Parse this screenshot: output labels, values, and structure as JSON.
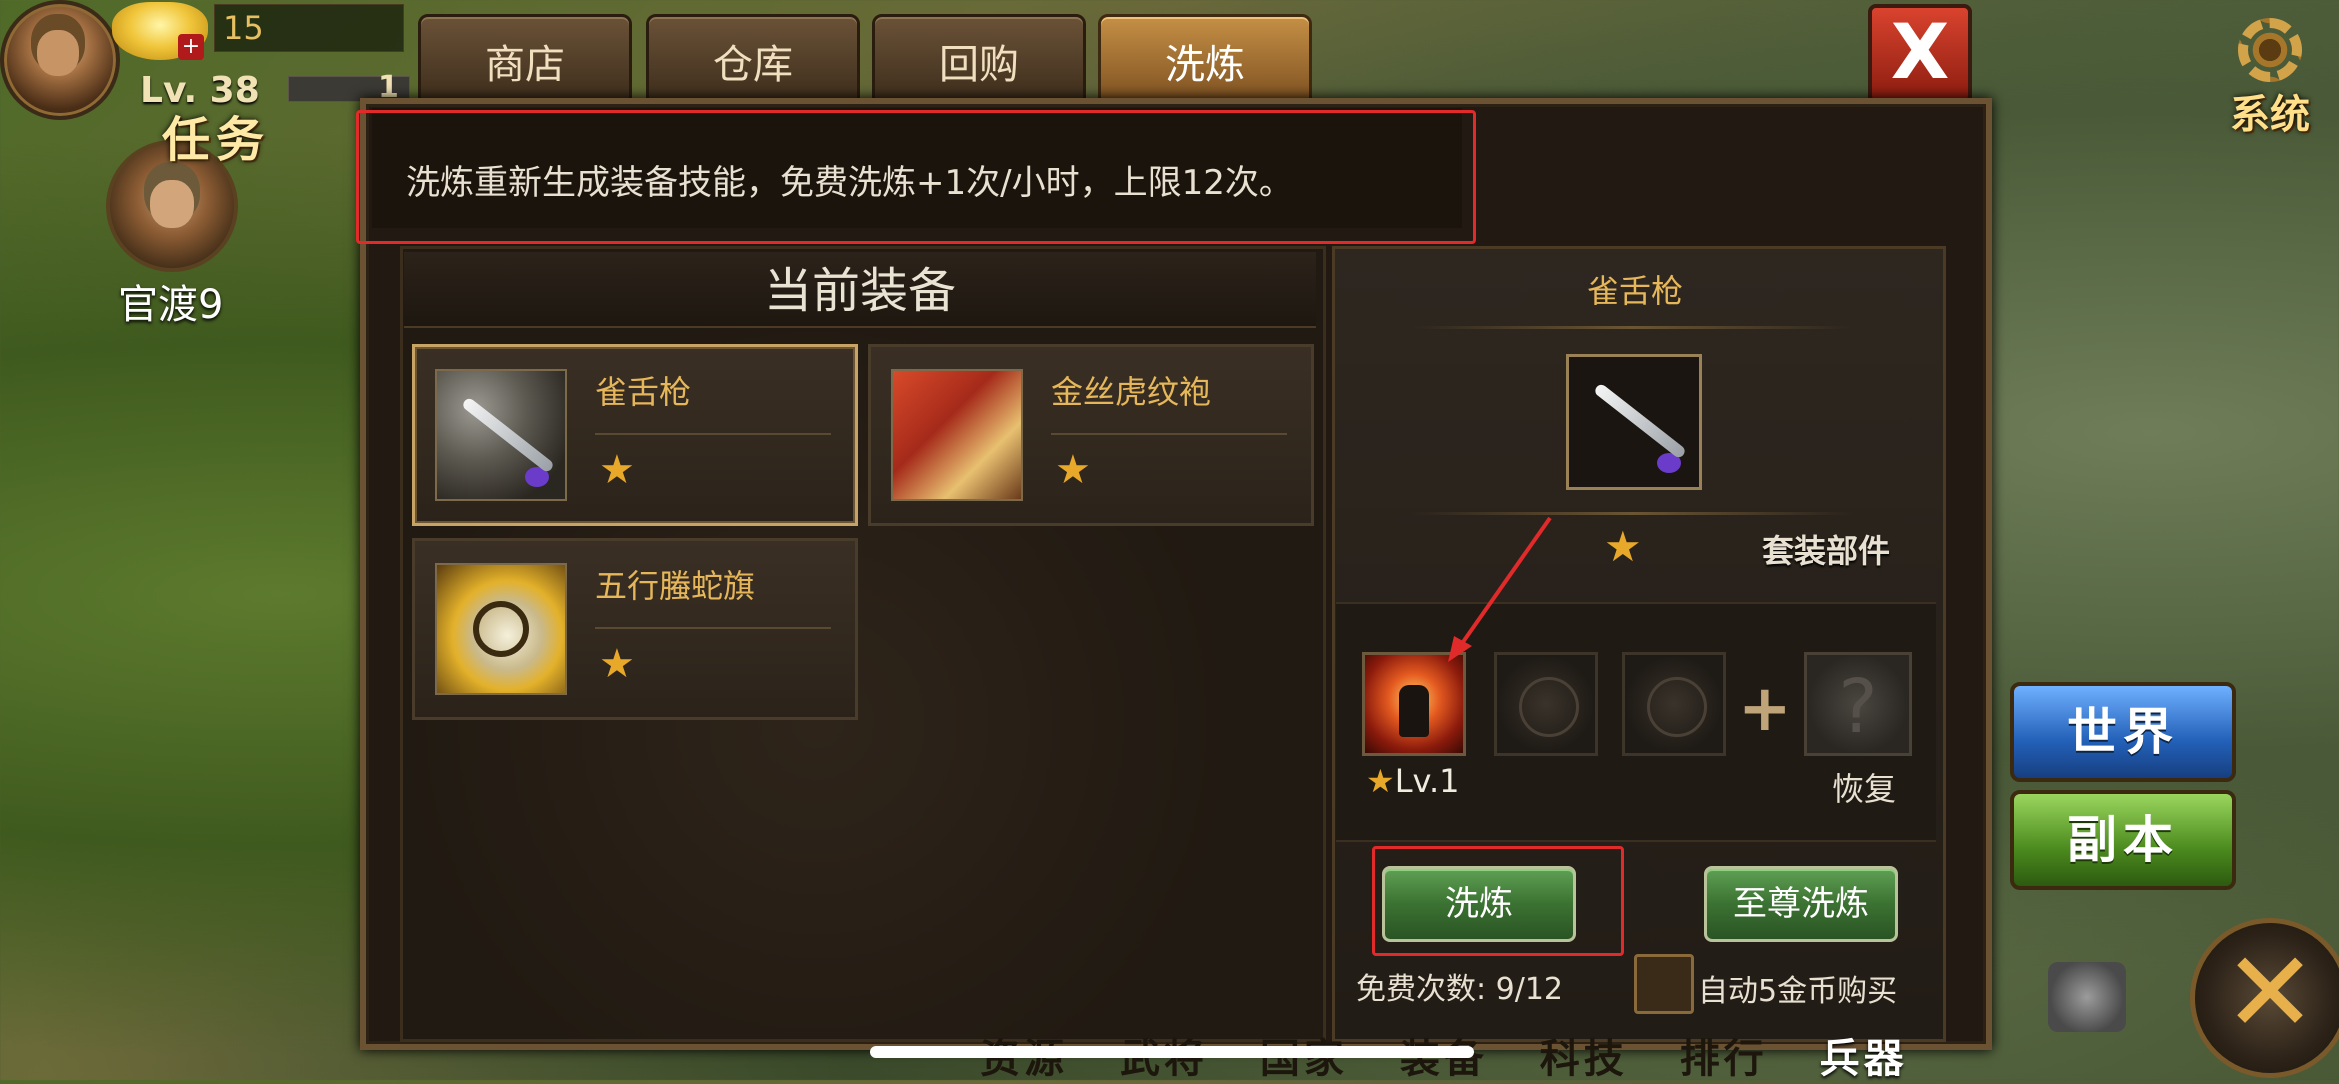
{
  "hud": {
    "gold_count": "15",
    "level": "Lv. 38",
    "exp_partial": "1",
    "quest_label": "任务",
    "location": "官渡9",
    "system_label": "系统"
  },
  "tabs": [
    {
      "label": "商店",
      "active": false
    },
    {
      "label": "仓库",
      "active": false
    },
    {
      "label": "回购",
      "active": false
    },
    {
      "label": "洗炼",
      "active": true
    }
  ],
  "close_label": "X",
  "notice": "洗炼重新生成装备技能，免费洗炼+1次/小时，上限12次。",
  "current_equipment": {
    "header": "当前装备",
    "items": [
      {
        "name": "雀舌枪",
        "star": "★",
        "selected": true,
        "icon": "spear-icon"
      },
      {
        "name": "金丝虎纹袍",
        "star": "★",
        "selected": false,
        "icon": "robe-icon"
      },
      {
        "name": "五行螣蛇旗",
        "star": "★",
        "selected": false,
        "icon": "banner-icon"
      }
    ]
  },
  "detail": {
    "title": "雀舌枪",
    "star": "★",
    "set_part_label": "套装部件",
    "skill_level": "Lv.1",
    "skill_star": "★",
    "restore_label": "恢复",
    "help_glyph": "?",
    "plus_glyph": "+"
  },
  "actions": {
    "refine_label": "洗炼",
    "supreme_refine_label": "至尊洗炼",
    "free_count": "免费次数: 9/12",
    "auto_buy_label": "自动5金币购买"
  },
  "side": {
    "world_label": "世界",
    "instance_label": "副本",
    "big_close_glyph": "✕"
  },
  "bottom_menu": [
    "资源",
    "武将",
    "国家",
    "装备",
    "科技",
    "排行",
    "兵器"
  ],
  "colors": {
    "highlight_outline": "#e12a2a",
    "gold_text": "#e6b75a",
    "star": "#e8a92b"
  }
}
